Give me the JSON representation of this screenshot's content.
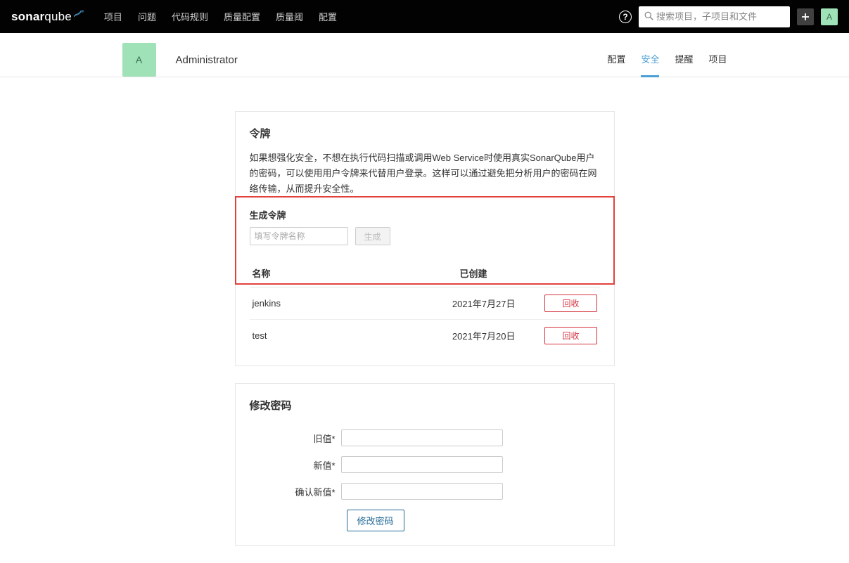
{
  "brand": {
    "bold": "sonar",
    "light": "qube"
  },
  "nav": {
    "items": [
      "项目",
      "问题",
      "代码规则",
      "质量配置",
      "质量阈",
      "配置"
    ]
  },
  "search": {
    "placeholder": "搜索项目，子项目和文件"
  },
  "avatar_char": "A",
  "user": {
    "name": "Administrator"
  },
  "subtabs": {
    "items": [
      "配置",
      "安全",
      "提醒",
      "项目"
    ],
    "active_index": 1
  },
  "tokens_panel": {
    "title": "令牌",
    "description": "如果想强化安全，不想在执行代码扫描或调用Web Service时使用真实SonarQube用户的密码，可以使用用户令牌来代替用户登录。这样可以通过避免把分析用户的密码在网络传输，从而提升安全性。",
    "generate_label": "生成令牌",
    "input_placeholder": "填写令牌名称",
    "generate_button": "生成",
    "columns": {
      "name": "名称",
      "created": "已创建"
    },
    "rows": [
      {
        "name": "jenkins",
        "created": "2021年7月27日",
        "revoke": "回收"
      },
      {
        "name": "test",
        "created": "2021年7月20日",
        "revoke": "回收"
      }
    ]
  },
  "password_panel": {
    "title": "修改密码",
    "old_label": "旧值*",
    "new_label": "新值*",
    "confirm_label": "确认新值*",
    "submit": "修改密码"
  }
}
